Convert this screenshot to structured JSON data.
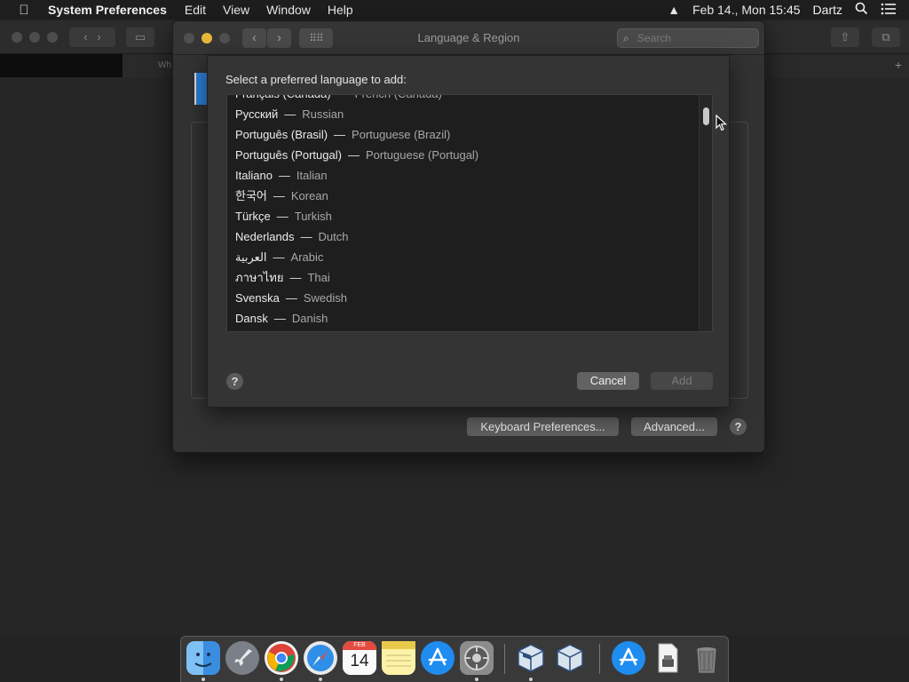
{
  "menubar": {
    "apple_glyph": "",
    "app_name": "System Preferences",
    "menus": [
      "Edit",
      "View",
      "Window",
      "Help"
    ],
    "clock": "Feb 14., Mon  15:45",
    "user": "Dartz"
  },
  "browser": {
    "tab_fragment": "Wh"
  },
  "window": {
    "title": "Language & Region",
    "search_placeholder": "Search",
    "keyboard_prefs_label": "Keyboard Preferences...",
    "advanced_label": "Advanced...",
    "help_label": "?"
  },
  "sheet": {
    "title": "Select a preferred language to add:",
    "languages": [
      {
        "native": "Français (Canada)",
        "english": "French (Canada)"
      },
      {
        "native": "Русский",
        "english": "Russian"
      },
      {
        "native": "Português (Brasil)",
        "english": "Portuguese (Brazil)"
      },
      {
        "native": "Português (Portugal)",
        "english": "Portuguese (Portugal)"
      },
      {
        "native": "Italiano",
        "english": "Italian"
      },
      {
        "native": "한국어",
        "english": "Korean"
      },
      {
        "native": "Türkçe",
        "english": "Turkish"
      },
      {
        "native": "Nederlands",
        "english": "Dutch"
      },
      {
        "native": "العربية",
        "english": "Arabic"
      },
      {
        "native": "ภาษาไทย",
        "english": "Thai"
      },
      {
        "native": "Svenska",
        "english": "Swedish"
      },
      {
        "native": "Dansk",
        "english": "Danish"
      }
    ],
    "separator": "—",
    "help_label": "?",
    "cancel_label": "Cancel",
    "add_label": "Add"
  },
  "dock": {
    "calendar_month": "FEB",
    "calendar_day": "14"
  },
  "colors": {
    "accent_minimize": "#e5b73b",
    "list_background": "#1e1e1e",
    "window_background": "#323232"
  }
}
